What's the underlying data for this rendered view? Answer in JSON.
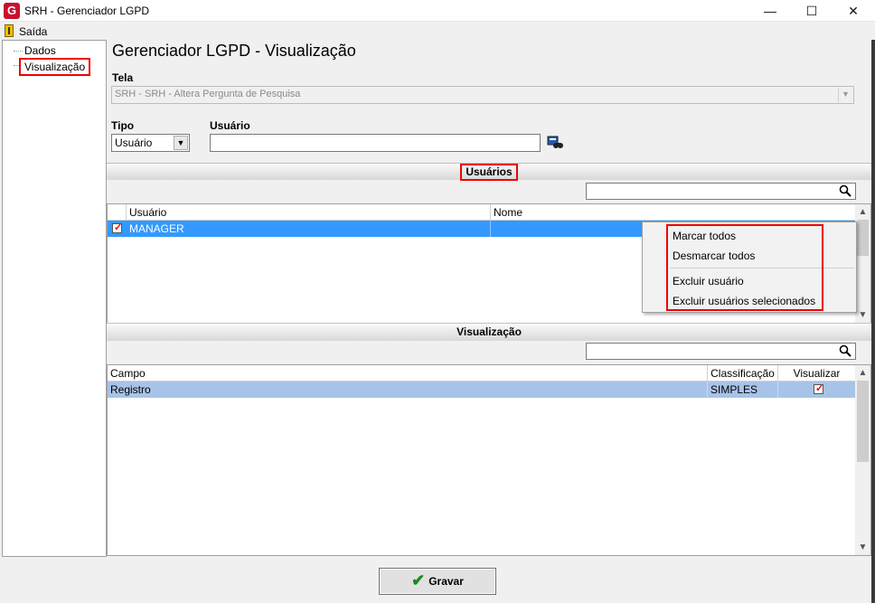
{
  "window": {
    "title": "SRH - Gerenciador LGPD",
    "icon_letter": "G",
    "minimize": "—",
    "maximize": "☐",
    "close": "✕"
  },
  "menu": {
    "exit_label": "Saída"
  },
  "tree": {
    "items": [
      "Dados",
      "Visualização"
    ]
  },
  "main": {
    "title": "Gerenciador LGPD - Visualização",
    "tela_label": "Tela",
    "tela_value": "SRH -  SRH - Altera Pergunta de Pesquisa",
    "tipo_label": "Tipo",
    "tipo_value": "Usuário",
    "usuario_label": "Usuário",
    "usuario_value": ""
  },
  "users_section": {
    "header": "Usuários",
    "search_value": "",
    "columns": [
      "Usuário",
      "Nome"
    ],
    "rows": [
      {
        "checked": true,
        "usuario": "MANAGER",
        "nome": ""
      }
    ]
  },
  "context_menu": {
    "items": [
      "Marcar todos",
      "Desmarcar todos",
      "Excluir usuário",
      "Excluir usuários selecionados"
    ]
  },
  "vis_section": {
    "header": "Visualização",
    "search_value": "",
    "columns": [
      "Campo",
      "Classificação",
      "Visualizar"
    ],
    "rows": [
      {
        "campo": "Registro",
        "classificacao": "SIMPLES",
        "visualizar": true
      }
    ]
  },
  "footer": {
    "save_label": "Gravar"
  },
  "colors": {
    "selection": "#3399ff",
    "highlight": "#e00000",
    "row_alt": "#a8c3e8"
  }
}
